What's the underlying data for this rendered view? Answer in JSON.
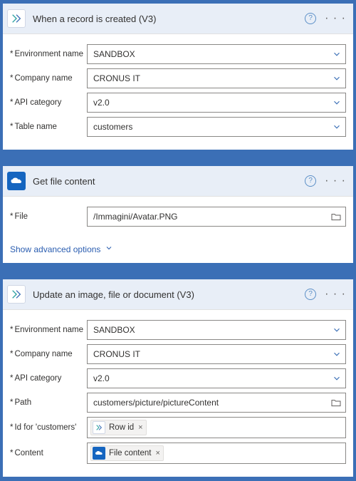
{
  "step1": {
    "title": "When a record is created (V3)",
    "fields": {
      "env_label": "Environment name",
      "env_value": "SANDBOX",
      "company_label": "Company name",
      "company_value": "CRONUS IT",
      "apicat_label": "API category",
      "apicat_value": "v2.0",
      "table_label": "Table name",
      "table_value": "customers"
    }
  },
  "step2": {
    "title": "Get file content",
    "fields": {
      "file_label": "File",
      "file_value": "/Immagini/Avatar.PNG"
    },
    "advanced_label": "Show advanced options"
  },
  "step3": {
    "title": "Update an image, file or document (V3)",
    "fields": {
      "env_label": "Environment name",
      "env_value": "SANDBOX",
      "company_label": "Company name",
      "company_value": "CRONUS IT",
      "apicat_label": "API category",
      "apicat_value": "v2.0",
      "path_label": "Path",
      "path_value": "customers/picture/pictureContent",
      "id_label": "Id for 'customers'",
      "id_token": "Row id",
      "content_label": "Content",
      "content_token": "File content"
    }
  }
}
